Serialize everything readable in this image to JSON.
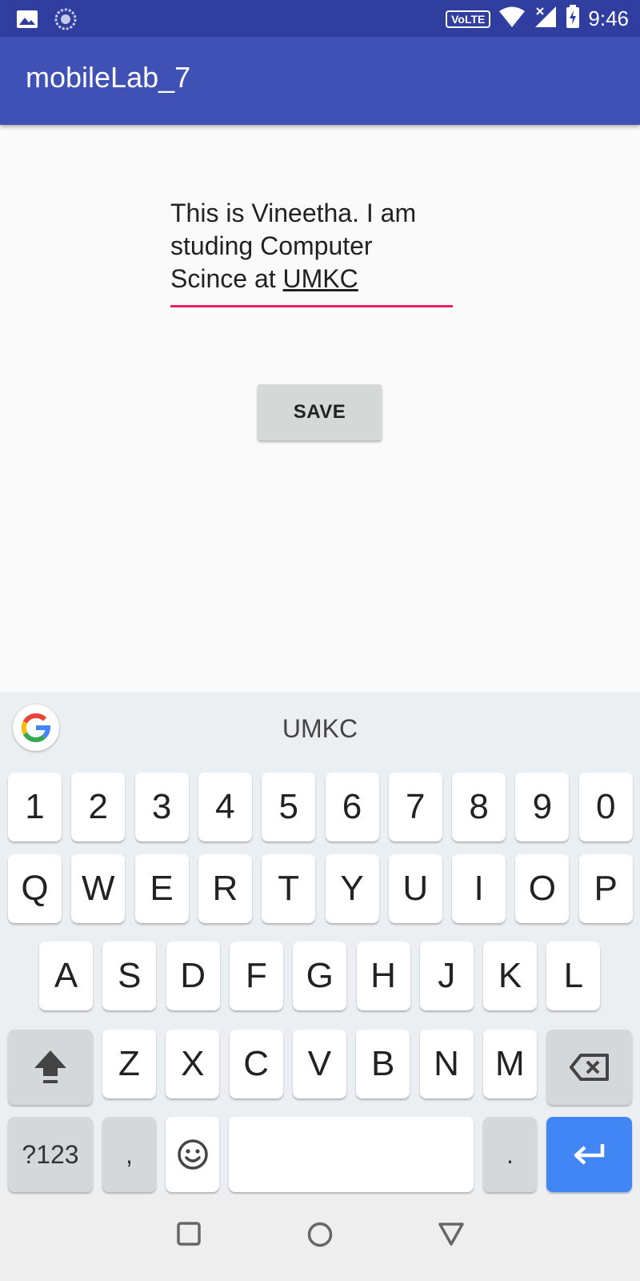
{
  "status_bar": {
    "left_icons": [
      "image-icon",
      "sync-icon"
    ],
    "volte": "VoLTE",
    "time": "9:46"
  },
  "app_bar": {
    "title": "mobileLab_7"
  },
  "edit_text": {
    "line1": "This is Vineetha. I am",
    "line2": "studing Computer",
    "line3_prefix": "Scince at ",
    "line3_underlined": "UMKC"
  },
  "save_button": {
    "label": "SAVE"
  },
  "keyboard": {
    "suggestion": "UMKC",
    "number_row": [
      "1",
      "2",
      "3",
      "4",
      "5",
      "6",
      "7",
      "8",
      "9",
      "0"
    ],
    "row1": [
      "Q",
      "W",
      "E",
      "R",
      "T",
      "Y",
      "U",
      "I",
      "O",
      "P"
    ],
    "row2": [
      "A",
      "S",
      "D",
      "F",
      "G",
      "H",
      "J",
      "K",
      "L"
    ],
    "row3": [
      "Z",
      "X",
      "C",
      "V",
      "B",
      "N",
      "M"
    ],
    "symbols_label": "?123",
    "comma": ",",
    "period": "."
  },
  "colors": {
    "status_bar": "#303f9f",
    "app_bar": "#3f51b5",
    "underline": "#e91e63",
    "enter_key": "#4285f4"
  }
}
